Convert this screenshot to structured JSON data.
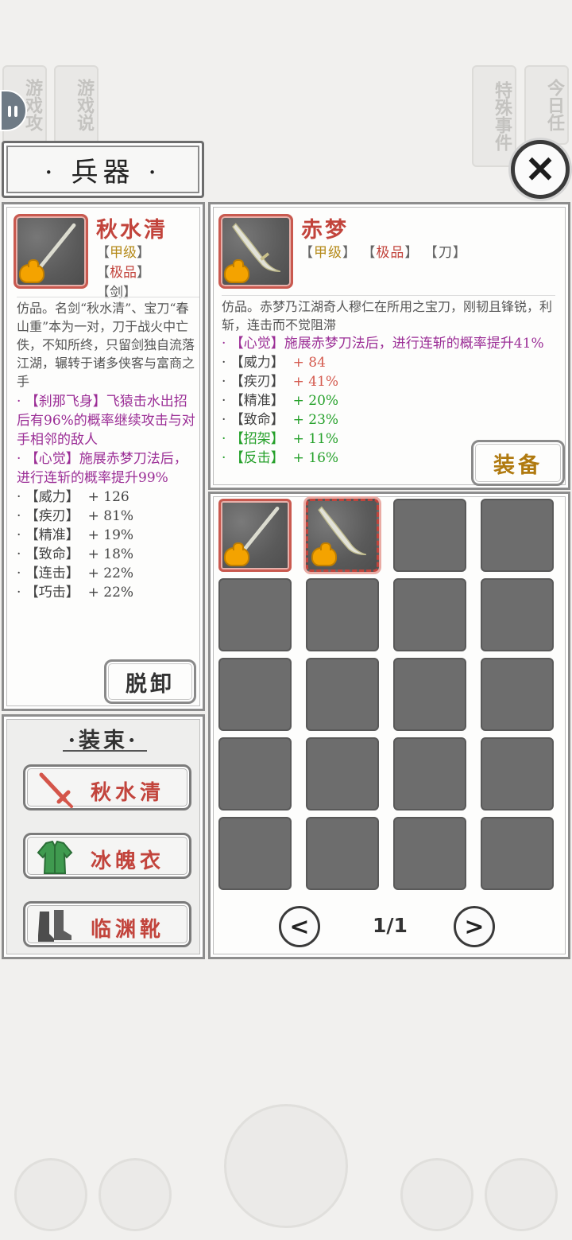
{
  "background": {
    "left_tabs": [
      "游戏攻",
      "游戏说"
    ],
    "right_tabs": [
      "特殊事件",
      "今日任"
    ]
  },
  "header": {
    "title": "· 兵器 ·"
  },
  "equipped": {
    "name": "秋水清",
    "tags": [
      {
        "text": "甲级",
        "color": "yellow"
      },
      {
        "text": "极品",
        "color": "red"
      },
      {
        "text": "剑",
        "color": "gray"
      }
    ],
    "description": "仿品。名剑“秋水清”、宝刀“春山重”本为一对，刀于战火中亡佚，不知所终，只留剑独自流落江湖，辗转于诸多侠客与富商之手",
    "skills": [
      "· 【刹那飞身】飞猿击水出招后有96%的概率继续攻击与对手相邻的敌人",
      "· 【心觉】施展赤梦刀法后，进行连斩的概率提升99%"
    ],
    "stats": [
      {
        "label": "· 【威力】",
        "value": "+ 126"
      },
      {
        "label": "· 【疾刃】",
        "value": "+ 81%"
      },
      {
        "label": "· 【精准】",
        "value": "+ 19%"
      },
      {
        "label": "· 【致命】",
        "value": "+ 18%"
      },
      {
        "label": "· 【连击】",
        "value": "+ 22%"
      },
      {
        "label": "· 【巧击】",
        "value": "+ 22%"
      }
    ],
    "unequip_label": "脱卸"
  },
  "selected": {
    "name": "赤梦",
    "tags": "【甲级】 【极品】 【刀】",
    "tag_parts": [
      "甲级",
      "极品",
      "刀"
    ],
    "description": "仿品。赤梦乃江湖奇人穆仁在所用之宝刀，刚韧且锋锐，利斩，连击而不觉阻滞",
    "skill": "· 【心觉】施展赤梦刀法后，进行连斩的概率提升41%",
    "stats": [
      {
        "label": "· 【威力】",
        "value": "+ 84",
        "color": "red"
      },
      {
        "label": "· 【疾刃】",
        "value": "+ 41%",
        "color": "red"
      },
      {
        "label": "· 【精准】",
        "value": "+ 20%",
        "color": "green"
      },
      {
        "label": "· 【致命】",
        "value": "+ 23%",
        "color": "green"
      },
      {
        "label": "· 【招架】",
        "value": "+ 11%",
        "color": "green",
        "label_green": true
      },
      {
        "label": "· 【反击】",
        "value": "+ 16%",
        "color": "green",
        "label_green": true
      }
    ],
    "equip_label": "装备"
  },
  "outfit": {
    "title": "·装束·",
    "items": [
      {
        "label": "秋水清",
        "icon": "sword-icon"
      },
      {
        "label": "冰魄衣",
        "icon": "robe-icon"
      },
      {
        "label": "临渊靴",
        "icon": "boots-icon"
      }
    ]
  },
  "inventory": {
    "page": "1/1",
    "prev_icon": "chevron-left-icon",
    "next_icon": "chevron-right-icon"
  },
  "colors": {
    "accent_red": "#c2443c",
    "tag_yellow": "#b58a1a",
    "skill_purple": "#9b2e96",
    "stat_green": "#26a12b",
    "slot_gray": "#6d6d6d"
  }
}
